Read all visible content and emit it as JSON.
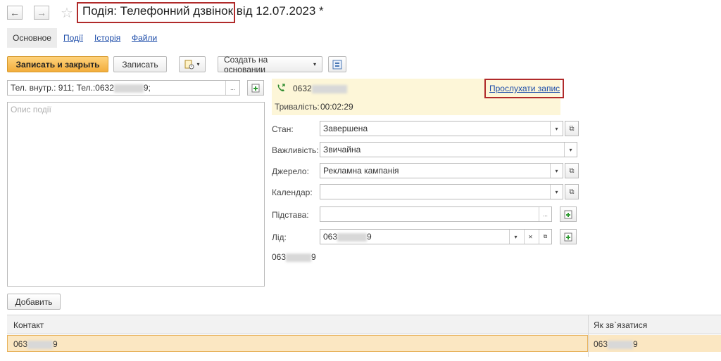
{
  "window": {
    "title": "Подія: Телефонний дзвінок від 12.07.2023 *"
  },
  "tabs": [
    {
      "label": "Основное"
    },
    {
      "label": "Події"
    },
    {
      "label": "Історія"
    },
    {
      "label": "Файли"
    }
  ],
  "toolbar": {
    "save_close_label": "Записать и закрыть",
    "save_label": "Записать",
    "create_based_label": "Создать на основании",
    "dropdown_arrow": "▾"
  },
  "left_panel": {
    "phone_field_value": "Тел. внутр.: 911; Тел.:0632",
    "phone_field_suffix": "9;",
    "description_placeholder": "Опис події",
    "ellipsis": "..."
  },
  "call_panel": {
    "number_prefix": "0632",
    "listen_label": "Прослухати запис",
    "duration_label": "Тривалість:",
    "duration_value": "00:02:29"
  },
  "form": {
    "status": {
      "label": "Стан:",
      "value": "Завершена"
    },
    "importance": {
      "label": "Важливість:",
      "value": "Звичайна"
    },
    "source": {
      "label": "Джерело:",
      "value": "Рекламна кампанія"
    },
    "calendar": {
      "label": "Календар:",
      "value": ""
    },
    "basis": {
      "label": "Підстава:",
      "value": ""
    },
    "lead": {
      "label": "Лід:",
      "value_prefix": "063",
      "value_suffix": "9"
    },
    "lead_phone_prefix": "063",
    "lead_phone_suffix": "9"
  },
  "contacts": {
    "add_label": "Добавить",
    "columns": [
      "Контакт",
      "Як зв`язатися"
    ],
    "rows": [
      {
        "contact_prefix": "063",
        "contact_suffix": "9",
        "reach_prefix": "063",
        "reach_suffix": "9"
      }
    ]
  },
  "colors": {
    "accent": "#f2ad3c",
    "highlight": "#b02a2a",
    "link": "#1f4eaa",
    "call_panel_bg": "#fdf6d8",
    "selected_row": "#fbe7c2"
  }
}
